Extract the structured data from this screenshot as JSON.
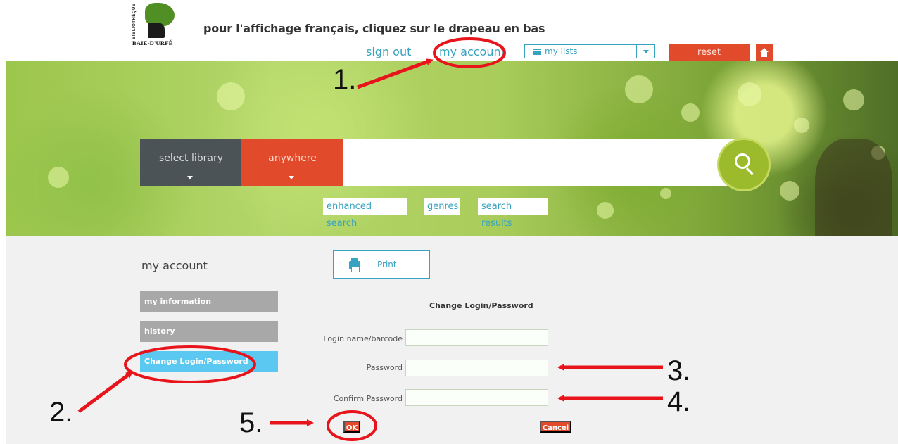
{
  "logo": {
    "vertical_text": "BIBLIOTHÈQUE",
    "name": "BAIE-D'URFÉ"
  },
  "header": {
    "french_note": "pour l'affichage français, cliquez sur le drapeau en bas",
    "sign_out": "sign out",
    "my_account": "my account",
    "my_lists": "my lists",
    "reset": "reset"
  },
  "search": {
    "select_library": "select library",
    "scope": "anywhere",
    "query": "",
    "subtabs": [
      "enhanced search",
      "genres",
      "search results"
    ]
  },
  "account": {
    "heading": "my account",
    "print": "Print",
    "sidebar": [
      "my information",
      "history",
      "Change Login/Password"
    ]
  },
  "form": {
    "title": "Change Login/Password",
    "login_label": "Login name/barcode",
    "password_label": "Password",
    "confirm_label": "Confirm Password",
    "ok": "OK",
    "cancel": "Cancel"
  },
  "annotations": {
    "steps": [
      "1.",
      "2.",
      "3.",
      "4.",
      "5."
    ],
    "color": "#e8141b"
  },
  "colors": {
    "accent_blue": "#37a3c0",
    "accent_orange": "#e14a2a",
    "active_sidebar": "#5ac8f0"
  }
}
